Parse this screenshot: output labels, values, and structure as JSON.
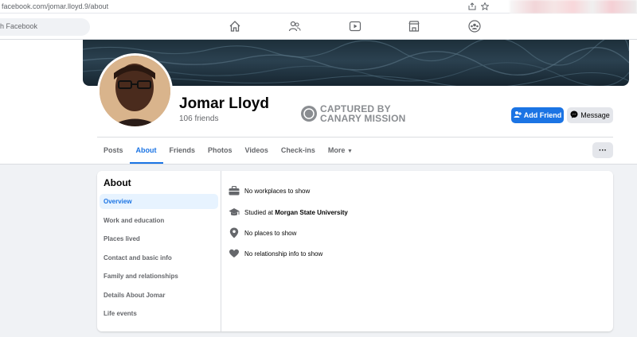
{
  "browser": {
    "url": "facebook.com/jomar.lloyd.9/about"
  },
  "topnav": {
    "search_placeholder": "h Facebook",
    "icons": [
      "home-icon",
      "friends-icon",
      "watch-icon",
      "marketplace-icon",
      "groups-icon"
    ]
  },
  "profile": {
    "name": "Jomar Lloyd",
    "friends": "106 friends",
    "stamp_line1": "CAPTURED BY",
    "stamp_line2": "CANARY MISSION",
    "add_friend": "Add Friend",
    "message": "Message",
    "more": "···"
  },
  "tabs": [
    {
      "label": "Posts"
    },
    {
      "label": "About"
    },
    {
      "label": "Friends"
    },
    {
      "label": "Photos"
    },
    {
      "label": "Videos"
    },
    {
      "label": "Check-ins"
    },
    {
      "label": "More"
    }
  ],
  "about": {
    "title": "About",
    "menu": [
      "Overview",
      "Work and education",
      "Places lived",
      "Contact and basic info",
      "Family and relationships",
      "Details About Jomar",
      "Life events"
    ],
    "info": {
      "work": "No workplaces to show",
      "studied_prefix": "Studied at ",
      "studied_school": "Morgan State University",
      "places": "No places to show",
      "relationship": "No relationship info to show"
    }
  },
  "colors": {
    "accent": "#1b74e4",
    "active_bg": "#e7f3ff",
    "page_bg": "#f0f2f5"
  }
}
